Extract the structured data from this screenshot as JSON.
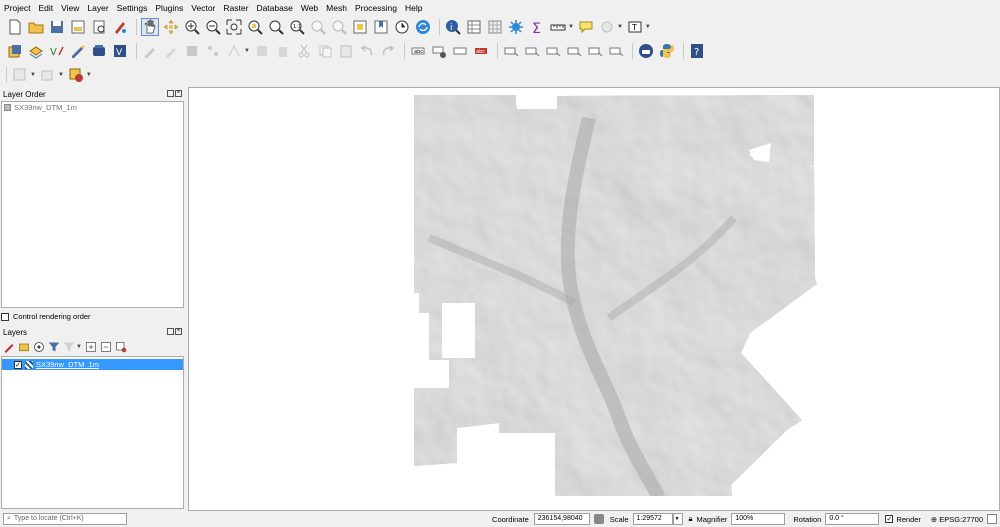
{
  "menu": [
    "Project",
    "Edit",
    "View",
    "Layer",
    "Settings",
    "Plugins",
    "Vector",
    "Raster",
    "Database",
    "Web",
    "Mesh",
    "Processing",
    "Help"
  ],
  "layer_order": {
    "title": "Layer Order",
    "items": [
      "SX39nw_DTM_1m"
    ],
    "control_rendering_label": "Control rendering order"
  },
  "layers": {
    "title": "Layers",
    "items": [
      {
        "name": "SX39nw_DTM_1m",
        "checked": true,
        "selected": true
      }
    ]
  },
  "statusbar": {
    "locator_placeholder": "Type to locate (Ctrl+K)",
    "coordinate_label": "Coordinate",
    "coordinate_value": "236154,98040",
    "scale_label": "Scale",
    "scale_value": "1:29572",
    "magnifier_label": "Magnifier",
    "magnifier_value": "100%",
    "rotation_label": "Rotation",
    "rotation_value": "0.0 °",
    "render_label": "Render",
    "render_checked": true,
    "crs_label": "EPSG:27700"
  },
  "colors": {
    "selection": "#3399ff",
    "hillshade": "#c4c4c4",
    "python": "#3a75a8"
  }
}
